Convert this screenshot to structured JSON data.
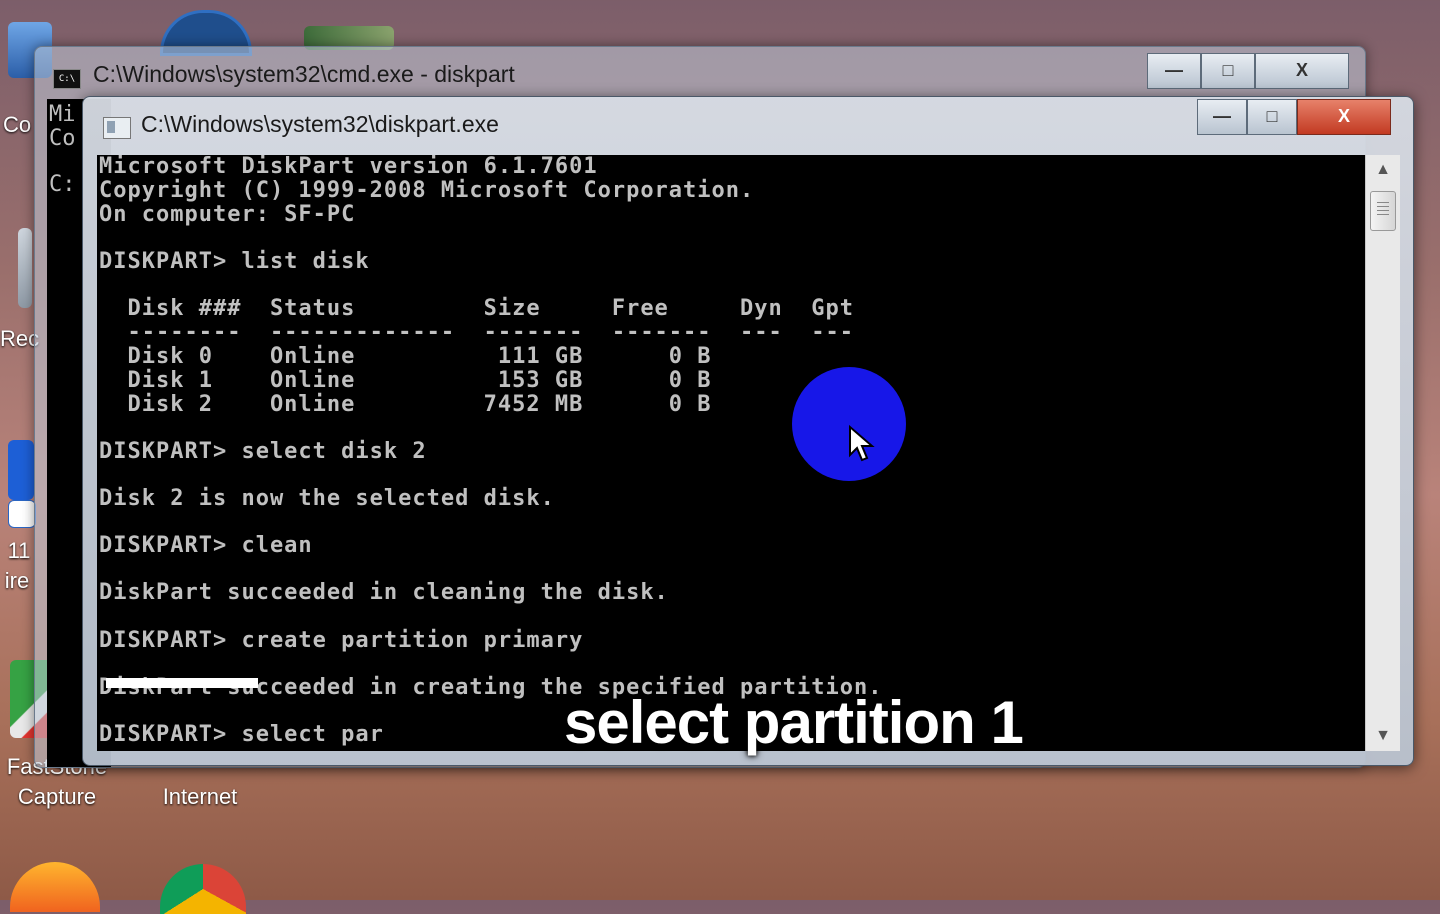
{
  "desktop": {
    "icons": [
      {
        "id": "co",
        "label": "Co"
      },
      {
        "id": "rec",
        "label": "Rec"
      },
      {
        "id": "n11",
        "label": "11"
      },
      {
        "id": "ire",
        "label": "ire"
      },
      {
        "id": "faststone",
        "label": "FastStone\nCapture"
      },
      {
        "id": "internet",
        "label": "Internet"
      }
    ]
  },
  "back_window": {
    "title": "C:\\Windows\\system32\\cmd.exe - diskpart",
    "console_lines": [
      "Mi",
      "Co",
      "",
      "C:"
    ],
    "buttons": {
      "minimize": "—",
      "maximize": "□",
      "close": "X"
    }
  },
  "front_window": {
    "title": "C:\\Windows\\system32\\diskpart.exe",
    "buttons": {
      "minimize": "—",
      "maximize": "□",
      "close": "X"
    },
    "terminal_lines": [
      "Microsoft DiskPart version 6.1.7601",
      "Copyright (C) 1999-2008 Microsoft Corporation.",
      "On computer: SF-PC",
      "",
      "DISKPART> list disk",
      "",
      "  Disk ###  Status         Size     Free     Dyn  Gpt",
      "  --------  -------------  -------  -------  ---  ---",
      "  Disk 0    Online          111 GB      0 B",
      "  Disk 1    Online          153 GB      0 B",
      "  Disk 2    Online         7452 MB      0 B",
      "",
      "DISKPART> select disk 2",
      "",
      "Disk 2 is now the selected disk.",
      "",
      "DISKPART> clean",
      "",
      "DiskPart succeeded in cleaning the disk.",
      "",
      "DISKPART> create partition primary",
      "",
      "DiskPart succeeded in creating the specified partition.",
      "",
      "DISKPART> select par"
    ],
    "scrollbar": {
      "up": "▲",
      "down": "▼"
    }
  },
  "overlay": {
    "caption": "select partition 1",
    "cursor_color": "#1717e8"
  }
}
